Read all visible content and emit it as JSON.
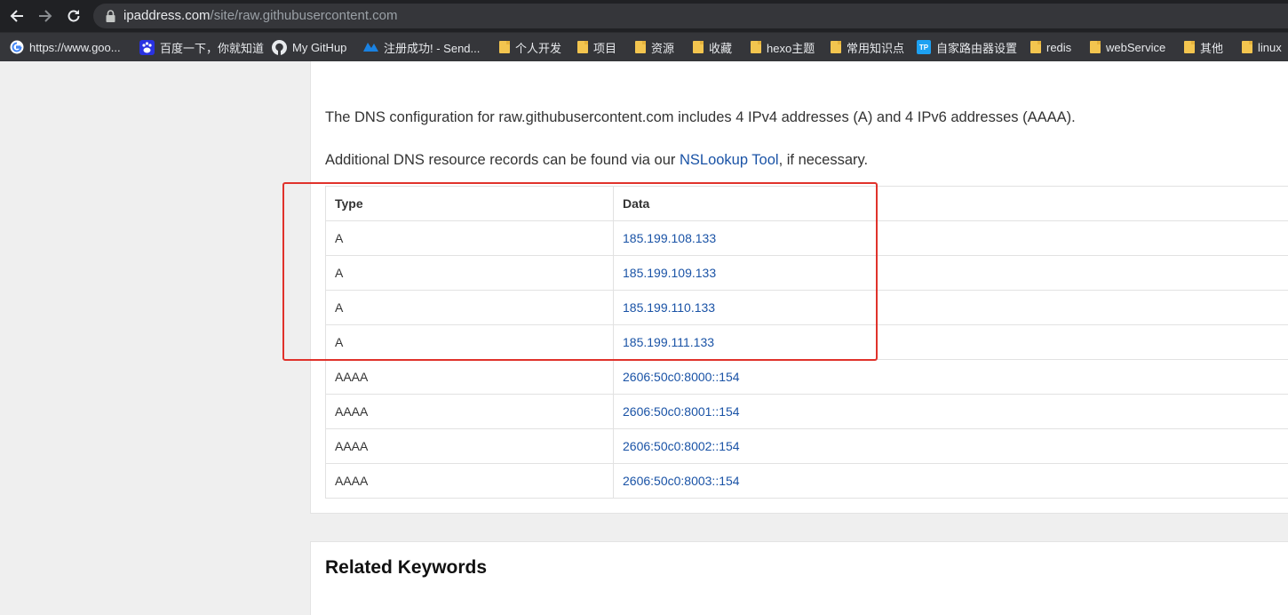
{
  "browser": {
    "url_domain": "ipaddress.com",
    "url_path": "/site/raw.githubusercontent.com"
  },
  "bookmarks": [
    {
      "label": "https://www.goo...",
      "icon": "google-icon"
    },
    {
      "label": "百度一下，你就知道",
      "icon": "baidu-icon"
    },
    {
      "label": "My GitHup",
      "icon": "github-icon"
    },
    {
      "label": "注册成功! - Send...",
      "icon": "sendgrid-icon"
    },
    {
      "label": "个人开发",
      "icon": "folder-icon"
    },
    {
      "label": "项目",
      "icon": "folder-icon"
    },
    {
      "label": "资源",
      "icon": "folder-icon"
    },
    {
      "label": "收藏",
      "icon": "folder-icon"
    },
    {
      "label": "hexo主题",
      "icon": "folder-icon"
    },
    {
      "label": "常用知识点",
      "icon": "folder-icon"
    },
    {
      "label": "自家路由器设置",
      "icon": "tplink-icon"
    },
    {
      "label": "redis",
      "icon": "folder-icon"
    },
    {
      "label": "webService",
      "icon": "folder-icon"
    },
    {
      "label": "其他",
      "icon": "folder-icon"
    },
    {
      "label": "linux",
      "icon": "folder-icon"
    }
  ],
  "content": {
    "intro": "The DNS configuration for raw.githubusercontent.com includes 4 IPv4 addresses (A) and 4 IPv6 addresses (AAAA).",
    "additional_prefix": "Additional DNS resource records can be found via our ",
    "additional_link": "NSLookup Tool",
    "additional_suffix": ", if necessary.",
    "table": {
      "headers": [
        "Type",
        "Data"
      ],
      "rows": [
        {
          "type": "A",
          "data": "185.199.108.133"
        },
        {
          "type": "A",
          "data": "185.199.109.133"
        },
        {
          "type": "A",
          "data": "185.199.110.133"
        },
        {
          "type": "A",
          "data": "185.199.111.133"
        },
        {
          "type": "AAAA",
          "data": "2606:50c0:8000::154"
        },
        {
          "type": "AAAA",
          "data": "2606:50c0:8001::154"
        },
        {
          "type": "AAAA",
          "data": "2606:50c0:8002::154"
        },
        {
          "type": "AAAA",
          "data": "2606:50c0:8003::154"
        }
      ]
    },
    "related_heading": "Related Keywords"
  },
  "colors": {
    "link": "#1a53a6",
    "highlight_box": "#e0322b"
  }
}
